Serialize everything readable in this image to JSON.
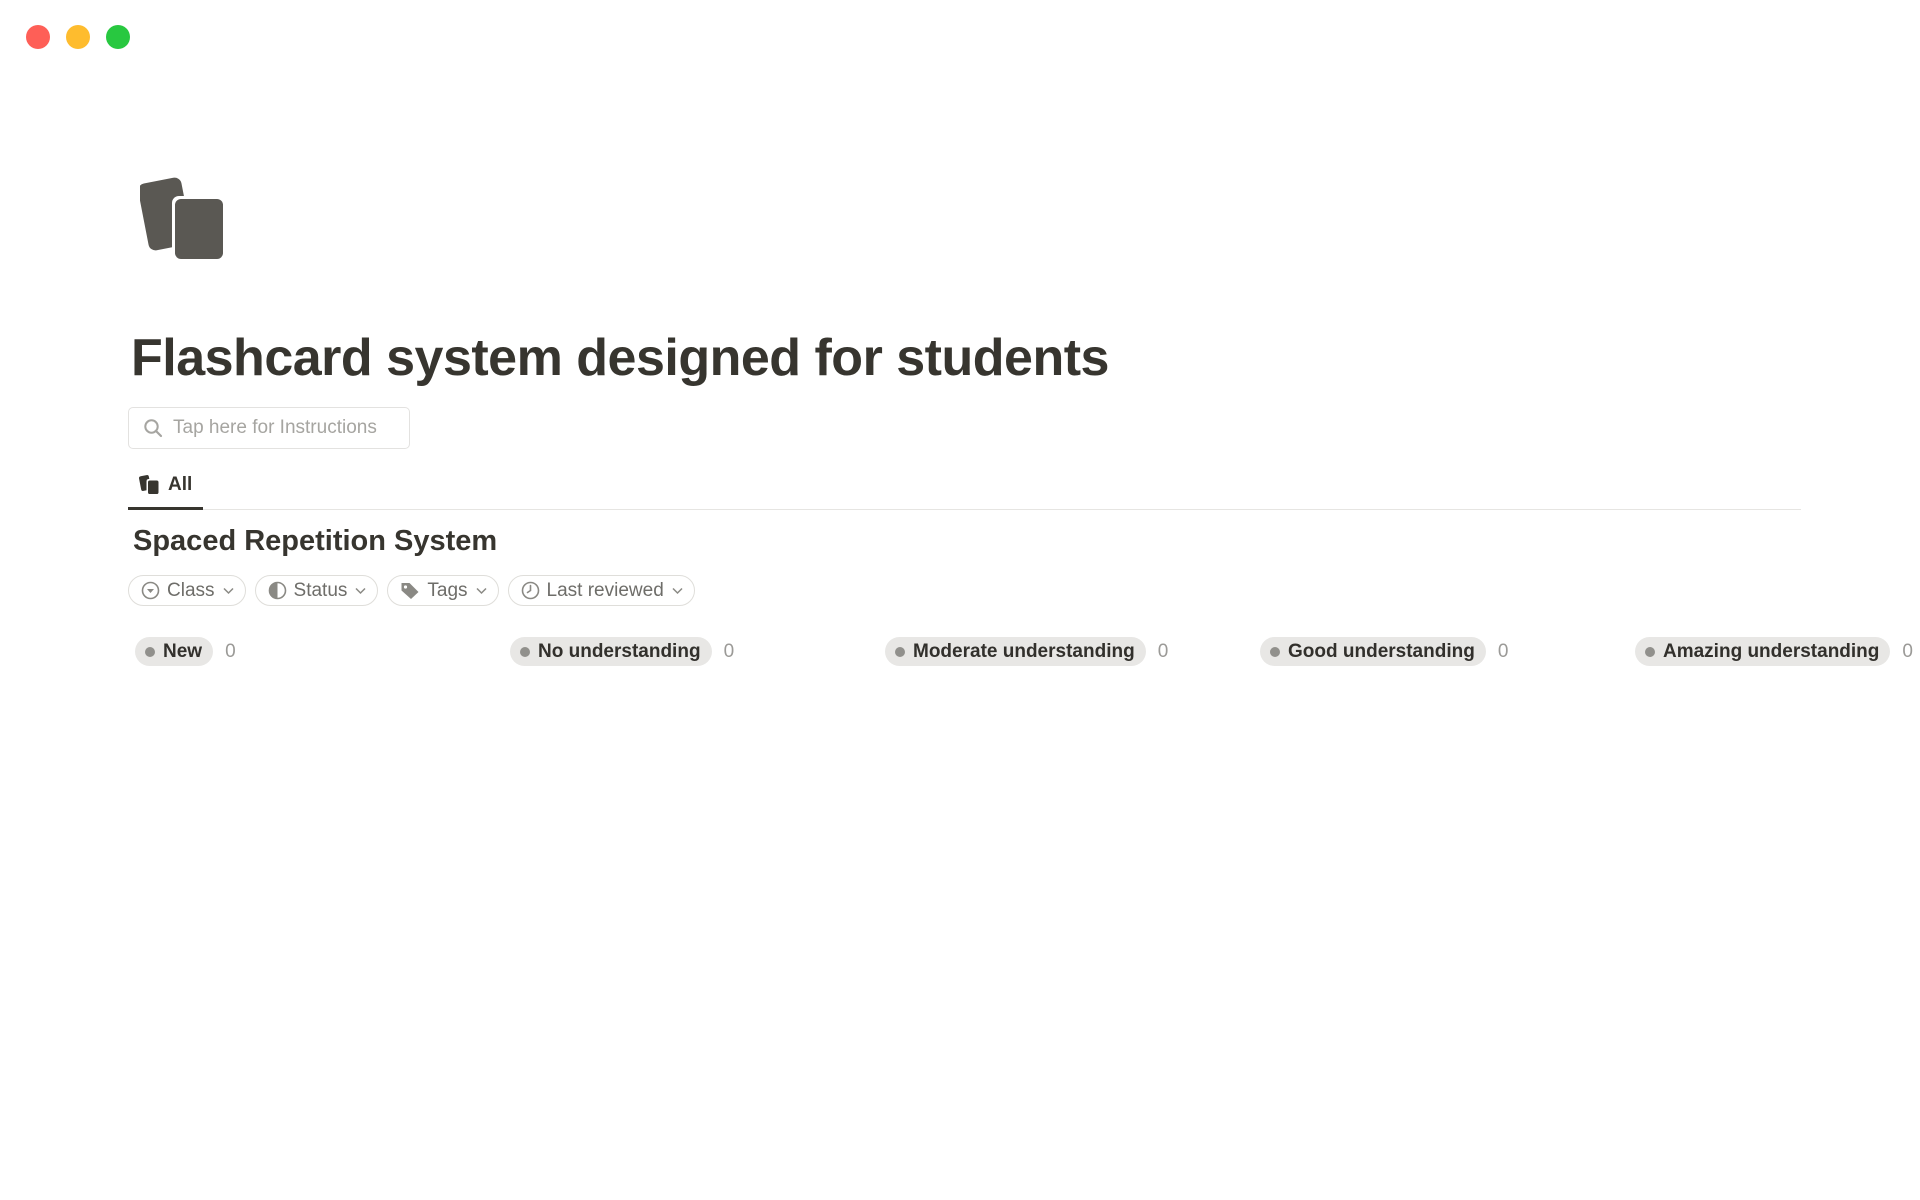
{
  "page": {
    "icon": "flashcards-icon",
    "title": "Flashcard system designed for students"
  },
  "search": {
    "placeholder": "Tap here for Instructions"
  },
  "tabs": [
    {
      "label": "All",
      "icon": "flashcards-icon",
      "active": true
    }
  ],
  "database": {
    "title": "Spaced Repetition System",
    "filters": [
      {
        "label": "Class",
        "icon": "select-icon"
      },
      {
        "label": "Status",
        "icon": "status-icon"
      },
      {
        "label": "Tags",
        "icon": "tag-icon"
      },
      {
        "label": "Last reviewed",
        "icon": "clock-icon"
      }
    ],
    "columns": [
      {
        "label": "New",
        "count": "0"
      },
      {
        "label": "No understanding",
        "count": "0"
      },
      {
        "label": "Moderate understanding",
        "count": "0"
      },
      {
        "label": "Good understanding",
        "count": "0"
      },
      {
        "label": "Amazing understanding",
        "count": "0"
      }
    ]
  },
  "colors": {
    "text": "#37352f",
    "pill_bg": "#e8e7e5",
    "pill_dot": "#91908c",
    "border": "#e3e2e0"
  }
}
